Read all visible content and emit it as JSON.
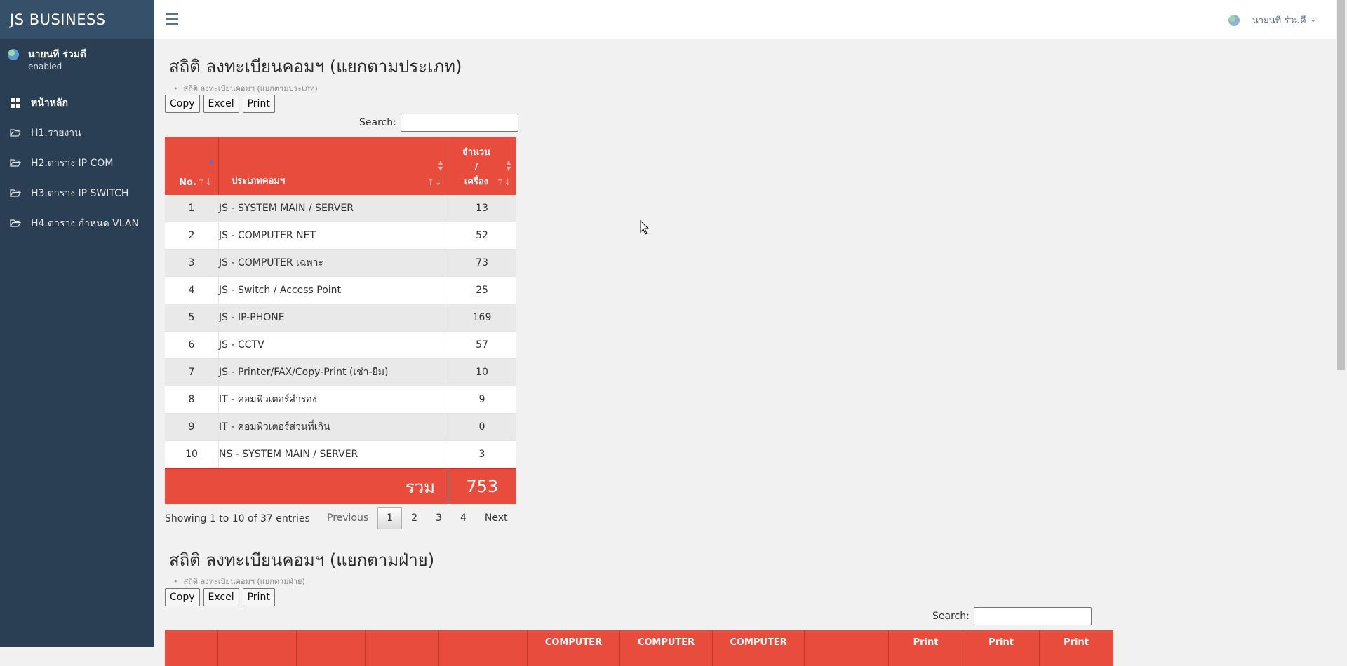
{
  "sidebar": {
    "brand": "JS  BUSINESS",
    "profile": {
      "name": "นายนที ร่วมดี",
      "status": "enabled"
    },
    "items": [
      {
        "label": "หน้าหลัก",
        "icon": "dashboard-icon"
      },
      {
        "label": "H1.รายงาน",
        "icon": "folder-open-icon"
      },
      {
        "label": "H2.ตาราง IP COM",
        "icon": "folder-open-icon"
      },
      {
        "label": "H3.ตาราง IP SWITCH",
        "icon": "folder-open-icon"
      },
      {
        "label": "H4.ตาราง กำหนด VLAN",
        "icon": "folder-open-icon"
      }
    ]
  },
  "topbar": {
    "user_name": "นายนที ร่วมดี",
    "menu_icon": "hamburger-icon",
    "chevron": "chevron-down-icon"
  },
  "colors": {
    "sidebar": "#2a3f54",
    "header_red": "#e74c3c",
    "brand_bg": "#36506a"
  },
  "section1": {
    "title": "สถิติ ลงทะเบียนคอมฯ (แยกตามประเภท)",
    "breadcrumb": "สถิติ ลงทะเบียนคอมฯ (แยกตามประเภท)",
    "buttons": {
      "copy": "Copy",
      "excel": "Excel",
      "print": "Print"
    },
    "search_label": "Search:",
    "search_value": "",
    "columns": {
      "no": "No.",
      "type": "ประเภทคอมฯ",
      "qty_line1": "จำนวน",
      "qty_line2": "/",
      "qty_line3": "เครื่อง"
    },
    "rows": [
      {
        "no": "1",
        "type": "JS - SYSTEM MAIN / SERVER",
        "qty": "13"
      },
      {
        "no": "2",
        "type": "JS - COMPUTER NET",
        "qty": "52"
      },
      {
        "no": "3",
        "type": "JS - COMPUTER เฉพาะ",
        "qty": "73"
      },
      {
        "no": "4",
        "type": "JS - Switch / Access Point",
        "qty": "25"
      },
      {
        "no": "5",
        "type": "JS - IP-PHONE",
        "qty": "169"
      },
      {
        "no": "6",
        "type": "JS - CCTV",
        "qty": "57"
      },
      {
        "no": "7",
        "type": "JS - Printer/FAX/Copy-Print (เช่า-ยืม)",
        "qty": "10"
      },
      {
        "no": "8",
        "type": "IT - คอมพิวเตอร์สำรอง",
        "qty": "9"
      },
      {
        "no": "9",
        "type": "IT - คอมพิวเตอร์ส่วนที่เกิน",
        "qty": "0"
      },
      {
        "no": "10",
        "type": "NS - SYSTEM MAIN / SERVER",
        "qty": "3"
      }
    ],
    "footer": {
      "label": "รวม",
      "total": "753"
    },
    "info": "Showing 1 to 10 of 37 entries",
    "pagination": {
      "previous": "Previous",
      "pages": [
        "1",
        "2",
        "3",
        "4"
      ],
      "current": "1",
      "next": "Next"
    }
  },
  "section2": {
    "title": "สถิติ ลงทะเบียนคอมฯ (แยกตามฝ่าย)",
    "breadcrumb": "สถิติ ลงทะเบียนคอมฯ (แยกตามฝ่าย)",
    "buttons": {
      "copy": "Copy",
      "excel": "Excel",
      "print": "Print"
    },
    "search_label": "Search:",
    "search_value": "",
    "columns": [
      "",
      "",
      "",
      "",
      "",
      "COMPUTER",
      "COMPUTER",
      "COMPUTER",
      "",
      "Print",
      "Print",
      "Print"
    ]
  }
}
